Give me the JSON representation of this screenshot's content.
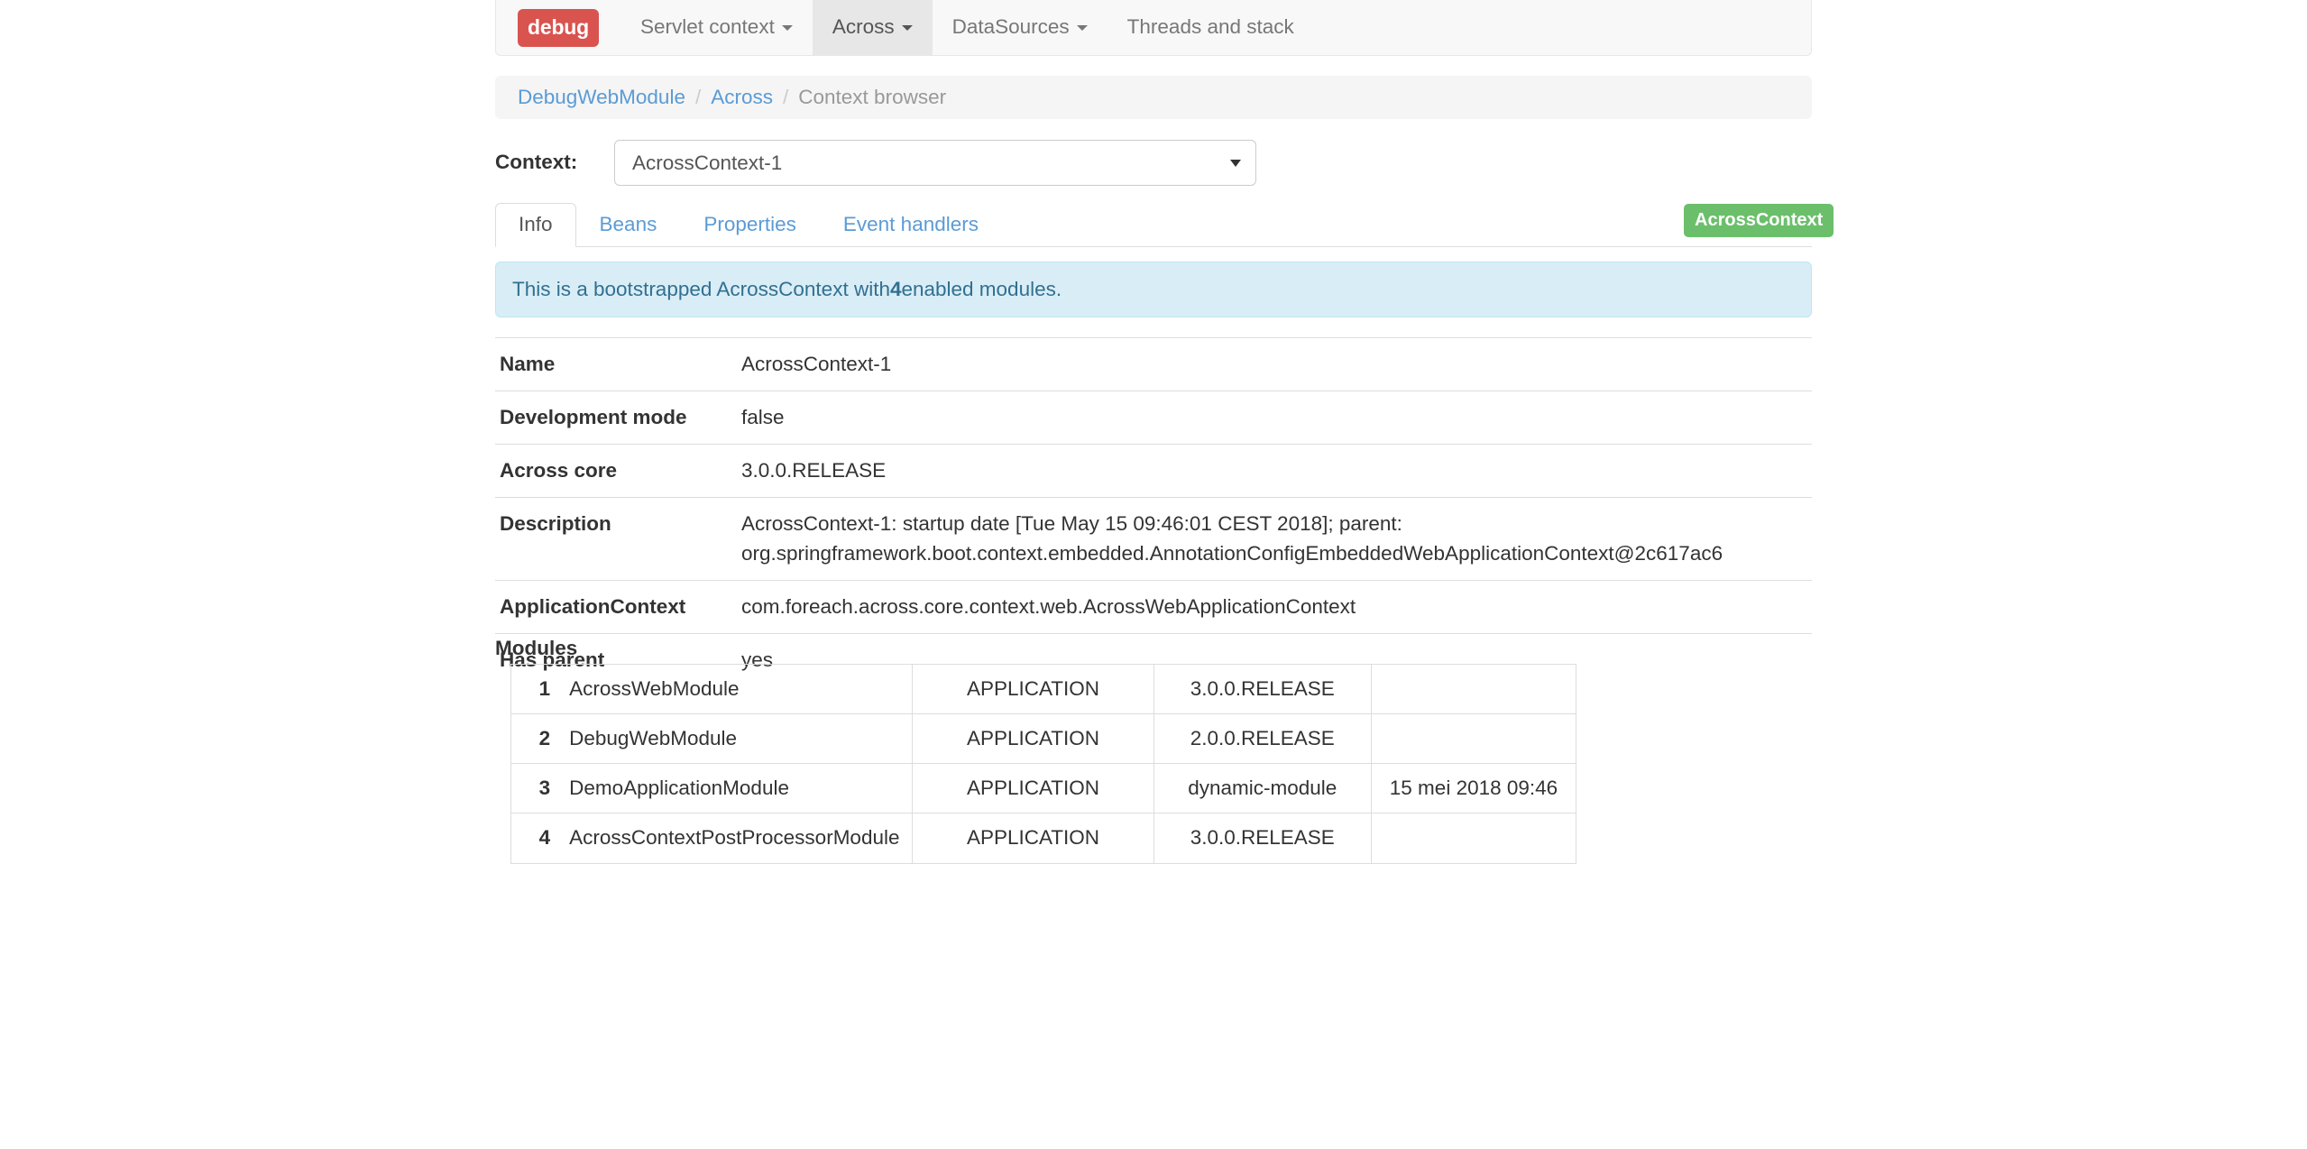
{
  "navbar": {
    "brand_label": "debug",
    "items": [
      {
        "label": "Servlet context",
        "has_caret": true,
        "active": false
      },
      {
        "label": "Across",
        "has_caret": true,
        "active": true
      },
      {
        "label": "DataSources",
        "has_caret": true,
        "active": false
      },
      {
        "label": "Threads and stack",
        "has_caret": false,
        "active": false
      }
    ]
  },
  "breadcrumb": {
    "items": [
      {
        "label": "DebugWebModule",
        "link": true
      },
      {
        "label": "Across",
        "link": true
      },
      {
        "label": "Context browser",
        "link": false
      }
    ],
    "separator": "/"
  },
  "context_form": {
    "label": "Context:",
    "selected": "AcrossContext-1",
    "options": [
      "AcrossContext-1"
    ]
  },
  "tabs": [
    {
      "label": "Info",
      "active": true
    },
    {
      "label": "Beans",
      "active": false
    },
    {
      "label": "Properties",
      "active": false
    },
    {
      "label": "Event handlers",
      "active": false
    }
  ],
  "badge": {
    "label": "AcrossContext",
    "color": "#6bbf6b"
  },
  "alert": {
    "text_before": "This is a bootstrapped AcrossContext with ",
    "count": "4",
    "text_after": " enabled modules.",
    "bg_color": "#d9edf7",
    "text_color": "#31708f"
  },
  "info_table": {
    "rows": [
      {
        "key": "Name",
        "value": "AcrossContext-1"
      },
      {
        "key": "Development mode",
        "value": "false"
      },
      {
        "key": "Across core",
        "value": "3.0.0.RELEASE"
      },
      {
        "key": "Description",
        "value": "AcrossContext-1: startup date [Tue May 15 09:46:01 CEST 2018]; parent: org.springframework.boot.context.embedded.AnnotationConfigEmbeddedWebApplicationContext@2c617ac6"
      },
      {
        "key": "ApplicationContext",
        "value": "com.foreach.across.core.context.web.AcrossWebApplicationContext"
      },
      {
        "key": "Has parent",
        "value": "yes"
      }
    ]
  },
  "modules": {
    "heading": "Modules",
    "rows": [
      {
        "index": "1",
        "name": "AcrossWebModule",
        "role": "APPLICATION",
        "version": "3.0.0.RELEASE",
        "timestamp": ""
      },
      {
        "index": "2",
        "name": "DebugWebModule",
        "role": "APPLICATION",
        "version": "2.0.0.RELEASE",
        "timestamp": ""
      },
      {
        "index": "3",
        "name": "DemoApplicationModule",
        "role": "APPLICATION",
        "version": "dynamic-module",
        "timestamp": "15 mei 2018 09:46"
      },
      {
        "index": "4",
        "name": "AcrossContextPostProcessorModule",
        "role": "APPLICATION",
        "version": "3.0.0.RELEASE",
        "timestamp": ""
      }
    ]
  }
}
